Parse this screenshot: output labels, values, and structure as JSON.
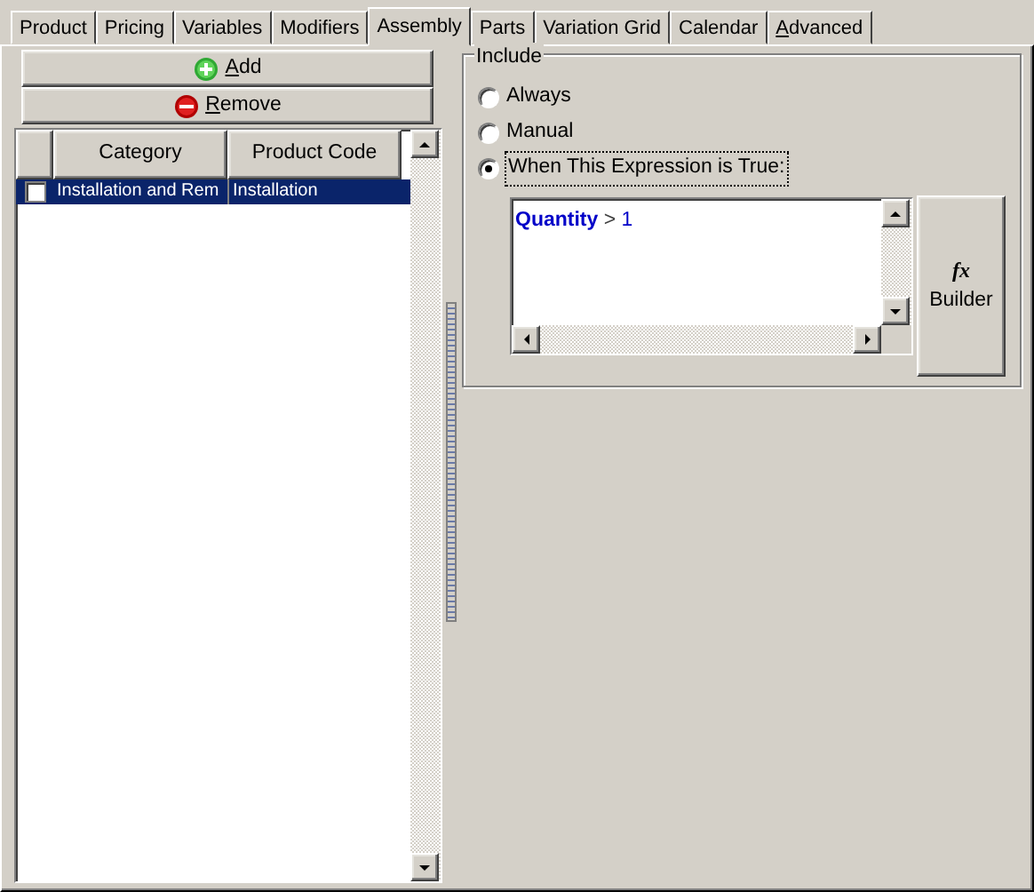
{
  "tabs": [
    {
      "label": "Product",
      "selected": false,
      "mnemonic": false
    },
    {
      "label": "Pricing",
      "selected": false,
      "mnemonic": false
    },
    {
      "label": "Variables",
      "selected": false,
      "mnemonic": false
    },
    {
      "label": "Modifiers",
      "selected": false,
      "mnemonic": false
    },
    {
      "label": "Assembly",
      "selected": true,
      "mnemonic": false
    },
    {
      "label": "Parts",
      "selected": false,
      "mnemonic": false
    },
    {
      "label": "Variation Grid",
      "selected": false,
      "mnemonic": false
    },
    {
      "label": "Calendar",
      "selected": false,
      "mnemonic": false
    },
    {
      "label": "Advanced",
      "selected": false,
      "mnemonic": true
    }
  ],
  "buttons": [
    {
      "label": "Add",
      "kind": "add",
      "mnemonic": true
    },
    {
      "label": "Remove",
      "kind": "remove",
      "mnemonic": true
    }
  ],
  "grid": {
    "columns": [
      "Category",
      "Product Code"
    ],
    "rows": [
      {
        "cells": [
          "Installation and Rem",
          "Installation"
        ],
        "checked": false,
        "selected": true
      }
    ]
  },
  "include": {
    "title": "Include",
    "options": [
      {
        "label": "Always",
        "selected": false
      },
      {
        "label": "Manual",
        "selected": false
      },
      {
        "label": "When This Expression is True:",
        "selected": true
      }
    ],
    "expression": [
      {
        "text": "Quantity",
        "kind": "field"
      },
      {
        "text": ">",
        "kind": "operator"
      },
      {
        "text": "1",
        "kind": "number"
      }
    ],
    "builder": {
      "icon": "fx",
      "label": "Builder"
    }
  }
}
